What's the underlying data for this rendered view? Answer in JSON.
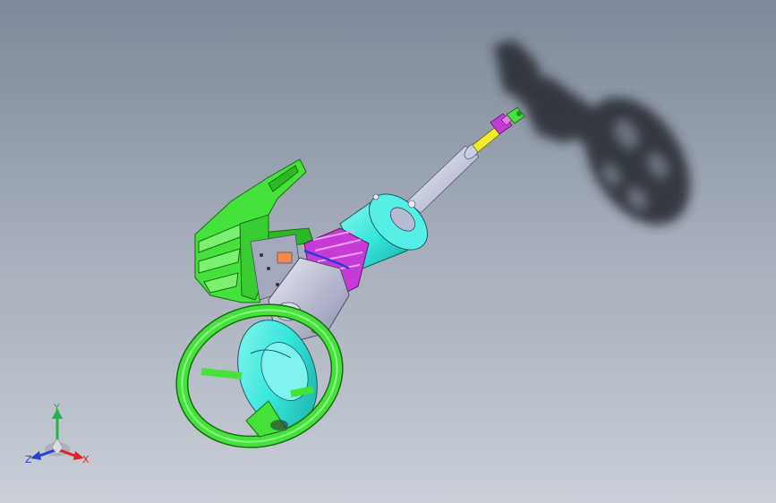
{
  "viewport": {
    "background_top": "#7d8898",
    "background_bottom": "#c9ced7",
    "model_colors": {
      "bracket": "#44e23a",
      "steering_wheel": "#44e23a",
      "column_housing": "#36e6dc",
      "boot": "#c63bd6",
      "shaft": "#d3d6e6",
      "yellow_shaft": "#f0ec2a",
      "shadow": "#2c2f36"
    }
  },
  "triad": {
    "x_label": "X",
    "y_label": "Y",
    "z_label": "Z",
    "x_color": "#e02424",
    "y_color": "#27b34a",
    "z_color": "#2340d8"
  }
}
